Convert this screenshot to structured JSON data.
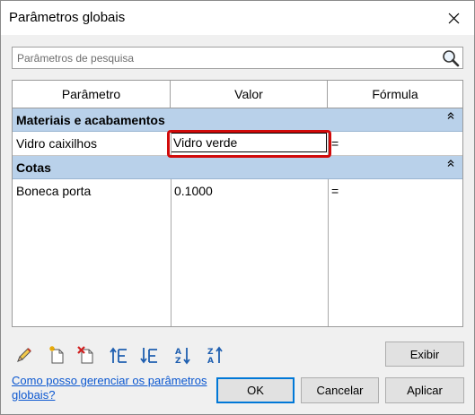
{
  "window": {
    "title": "Parâmetros globais"
  },
  "search": {
    "placeholder": "Parâmetros de pesquisa",
    "value": ""
  },
  "table": {
    "headers": [
      "Parâmetro",
      "Valor",
      "Fórmula"
    ],
    "groups": [
      {
        "name": "Materiais e acabamentos",
        "rows": [
          {
            "parameter": "Vidro caixilhos",
            "value": "Vidro verde",
            "formula": "="
          }
        ]
      },
      {
        "name": "Cotas",
        "rows": [
          {
            "parameter": "Boneca porta",
            "value": "0.1000",
            "formula": "="
          }
        ]
      }
    ]
  },
  "toolbar": {
    "icons": [
      "edit-icon",
      "new-parameter-icon",
      "delete-parameter-icon",
      "move-up-icon",
      "move-down-icon",
      "sort-ascending-icon",
      "sort-descending-icon"
    ]
  },
  "buttons": {
    "show": "Exibir",
    "ok": "OK",
    "cancel": "Cancelar",
    "apply": "Aplicar"
  },
  "help": {
    "link": "Como posso gerenciar os parâmetros globais?"
  },
  "colors": {
    "group_header": "#b9d1ea",
    "highlight": "#d10a0a",
    "link": "#0b57d0",
    "focus_border": "#0078d7"
  }
}
